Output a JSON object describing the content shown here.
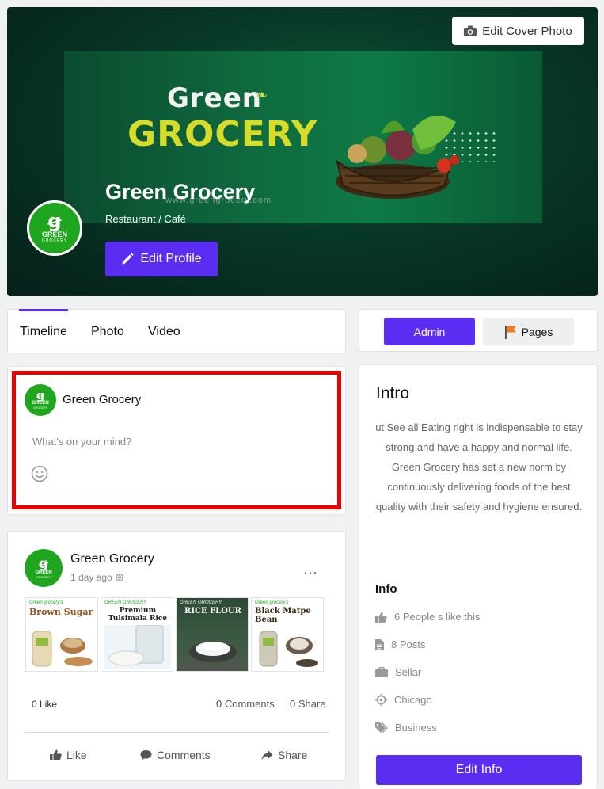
{
  "cover": {
    "edit_cover_label": "Edit Cover Photo",
    "banner": {
      "word1": "Green",
      "word2": "GROCERY",
      "url": "www.greengrocery.com"
    },
    "avatar": {
      "glyph": "ꞡ",
      "line1": "GREEN",
      "line2": "GROCERY"
    },
    "name": "Green Grocery",
    "category": "Restaurant / Café",
    "edit_profile_label": "Edit Profile"
  },
  "tabs": [
    "Timeline",
    "Photo",
    "Video"
  ],
  "side_buttons": {
    "admin": "Admin",
    "pages": "Pages"
  },
  "composer": {
    "name": "Green Grocery",
    "placeholder": "What's on your mind?"
  },
  "post": {
    "author": "Green Grocery",
    "time": "1 day ago",
    "products": [
      {
        "brand": "Green grocery's",
        "title": "Brown Sugar"
      },
      {
        "brand": "GREEN GROCERY",
        "title": "Premium Tulsimala Rice"
      },
      {
        "brand": "GREEN GROCERY",
        "title": "RICE FLOUR"
      },
      {
        "brand": "Green grocery's",
        "title": "Black Matpe Bean"
      }
    ],
    "likes": "0 Like",
    "comments": "0 Comments",
    "shares": "0 Share",
    "actions": {
      "like": "Like",
      "comments": "Comments",
      "share": "Share"
    }
  },
  "intro": {
    "title": "Intro",
    "text": "ut See all Eating right is indispensable to stay strong and have a happy and normal life. Green Grocery has set a new norm by continuously delivering foods of the best quality with their safety and hygiene ensured.",
    "info_title": "Info",
    "info": [
      {
        "icon": "thumbs-up-icon",
        "text": "6 People s like this"
      },
      {
        "icon": "document-icon",
        "text": "8 Posts"
      },
      {
        "icon": "briefcase-icon",
        "text": "Sellar"
      },
      {
        "icon": "location-icon",
        "text": "Chicago"
      },
      {
        "icon": "tag-icon",
        "text": "Business"
      }
    ],
    "edit_info_label": "Edit Info"
  },
  "colors": {
    "accent": "#5b2cf1",
    "brand_green": "#1fa51e",
    "highlight": "#ee0000"
  }
}
